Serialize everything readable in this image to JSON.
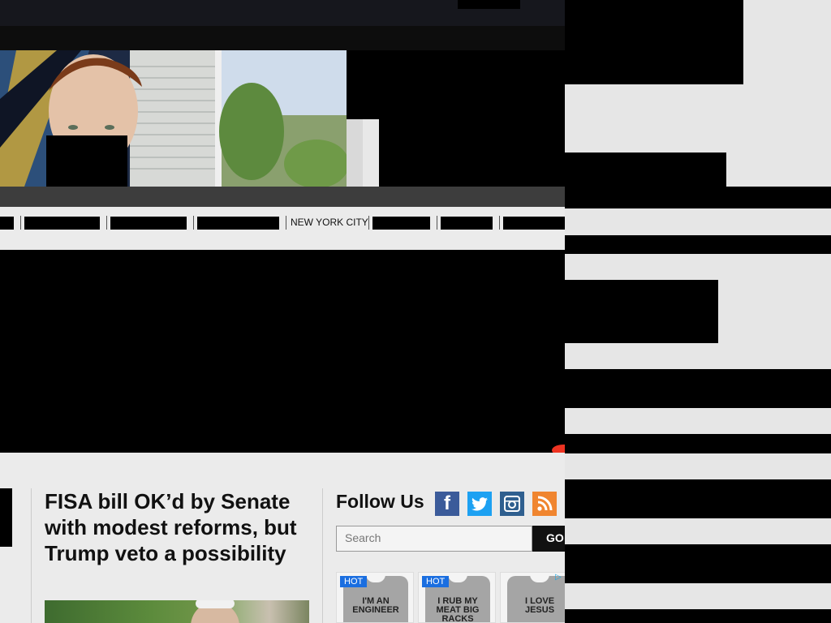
{
  "nav": {
    "items": [
      "",
      "",
      "",
      "",
      "NEW YORK CITY",
      "",
      "",
      ""
    ],
    "highlight_label": "NEW YORK CITY"
  },
  "article": {
    "headline": "FISA bill OK’d by Senate with modest reforms, but Trump veto a possibility"
  },
  "sidebar": {
    "follow_title": "Follow Us",
    "social": [
      {
        "icon": "facebook-icon",
        "glyph": "f",
        "color": "#3b5b9a"
      },
      {
        "icon": "twitter-icon",
        "glyph": "🐦",
        "color": "#1da1f2"
      },
      {
        "icon": "instagram-icon",
        "glyph": "◎",
        "color": "#2f5f8f"
      },
      {
        "icon": "rss-icon",
        "glyph": "⌇",
        "color": "#f0852f"
      }
    ],
    "search_placeholder": "Search",
    "go_label": "GO"
  },
  "ads": {
    "shirts": [
      {
        "badge": "HOT",
        "text": "I'M AN ENGINEER"
      },
      {
        "badge": "HOT",
        "text": "I RUB MY MEAT BIG RACKS"
      },
      {
        "badge": "",
        "text": "I LOVE JESUS"
      }
    ]
  }
}
